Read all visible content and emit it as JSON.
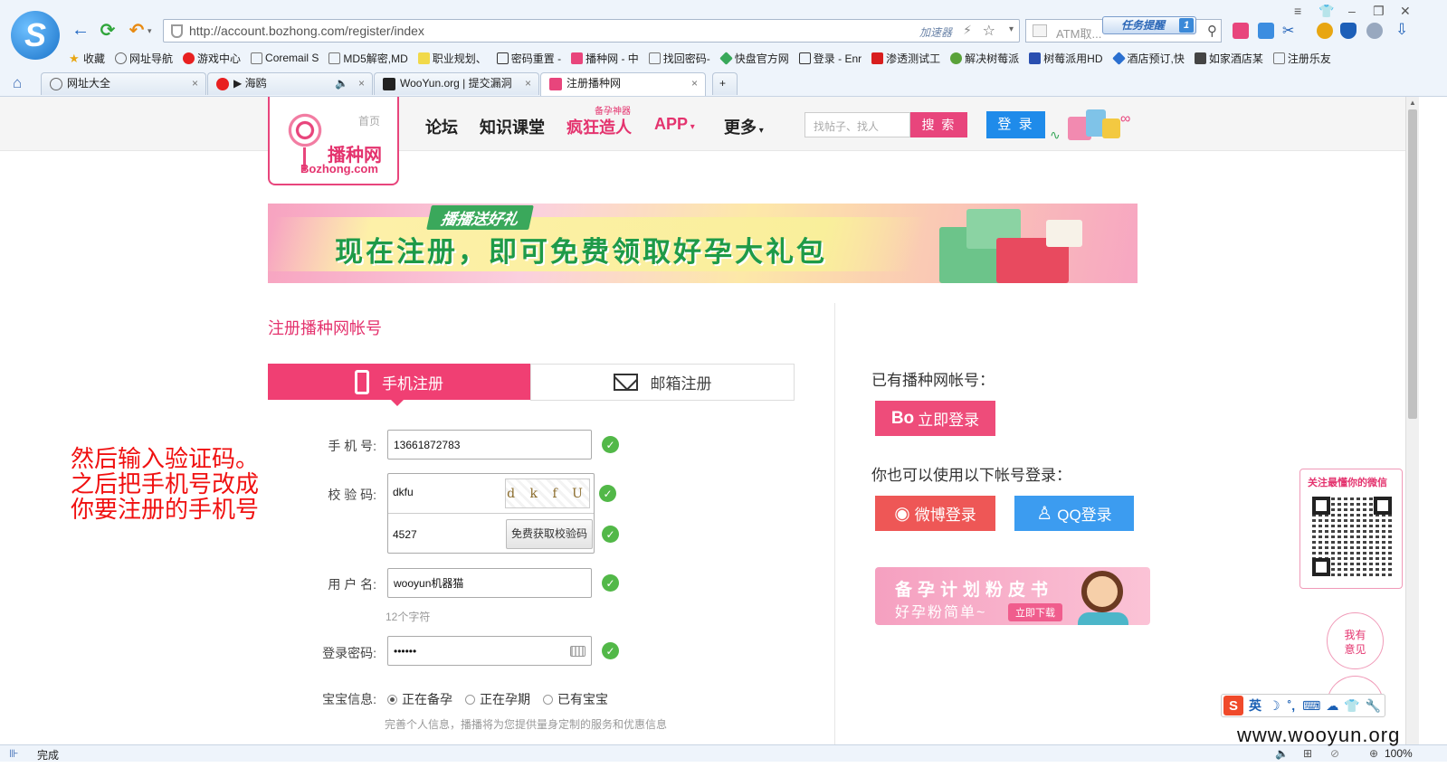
{
  "browser": {
    "url": "http://account.bozhong.com/register/index",
    "accelerator_label": "加速器",
    "search_placeholder": "ATM取...",
    "task_label": "任务提醒",
    "task_count": "1",
    "status_text": "完成",
    "zoom": "100%",
    "bookmarks": [
      "收藏",
      "网址导航",
      "游戏中心",
      "Coremail S",
      "MD5解密,MD",
      "职业规划、",
      "密码重置 -",
      "播种网 - 中",
      "找回密码-",
      "快盘官方网",
      "登录 - Enr",
      "渗透测试工",
      "解决树莓派",
      "树莓派用HD",
      "酒店预订,快",
      "如家酒店某",
      "注册乐友"
    ],
    "tabs": [
      "网址大全",
      "▶ 海鸥",
      "WooYun.org | 提交漏洞",
      "注册播种网"
    ]
  },
  "site": {
    "logo_home": "首页",
    "logo_cn": "播种网",
    "logo_en": "Bozhong.com",
    "nav": [
      "论坛",
      "知识课堂",
      "疯狂造人",
      "APP",
      "更多"
    ],
    "crazy_sub": "备孕神器",
    "search_placeholder": "找帖子、找人",
    "search_button": "搜 索",
    "login_button": "登 录"
  },
  "banner": {
    "tag": "播播送好礼",
    "main": "现在注册，即可免费领取好孕大礼包"
  },
  "form": {
    "title": "注册播种网帐号",
    "tab_phone": "手机注册",
    "tab_email": "邮箱注册",
    "phone_label": "手 机 号:",
    "phone_value": "13661872783",
    "captcha_label": "校 验 码:",
    "captcha_value": "dkfu",
    "captcha_image_text": "d k f U",
    "sms_value": "4527",
    "sms_button": "免费获取校验码",
    "username_label": "用 户 名:",
    "username_value": "wooyun机器猫",
    "username_hint": "12个字符",
    "password_label": "登录密码:",
    "password_value": "••••••",
    "baby_label": "宝宝信息:",
    "baby_options": [
      "正在备孕",
      "正在孕期",
      "已有宝宝"
    ],
    "baby_hint": "完善个人信息，播播将为您提供量身定制的服务和优惠信息"
  },
  "annotation": [
    "然后输入验证码。",
    "之后把手机号改成",
    "你要注册的手机号"
  ],
  "right": {
    "have_account": "已有播种网帐号：",
    "login_now": "立即登录",
    "other_login": "你也可以使用以下帐号登录：",
    "weibo": "微博登录",
    "qq": "QQ登录",
    "promo_line1": "备孕计划粉皮书",
    "promo_line2": "好孕粉简单~",
    "promo_download": "立即下载",
    "wechat": "关注最懂你的微信",
    "feedback": [
      "我有",
      "意见"
    ]
  },
  "ime": {
    "lang": "英"
  },
  "watermark": "www.wooyun.org"
}
